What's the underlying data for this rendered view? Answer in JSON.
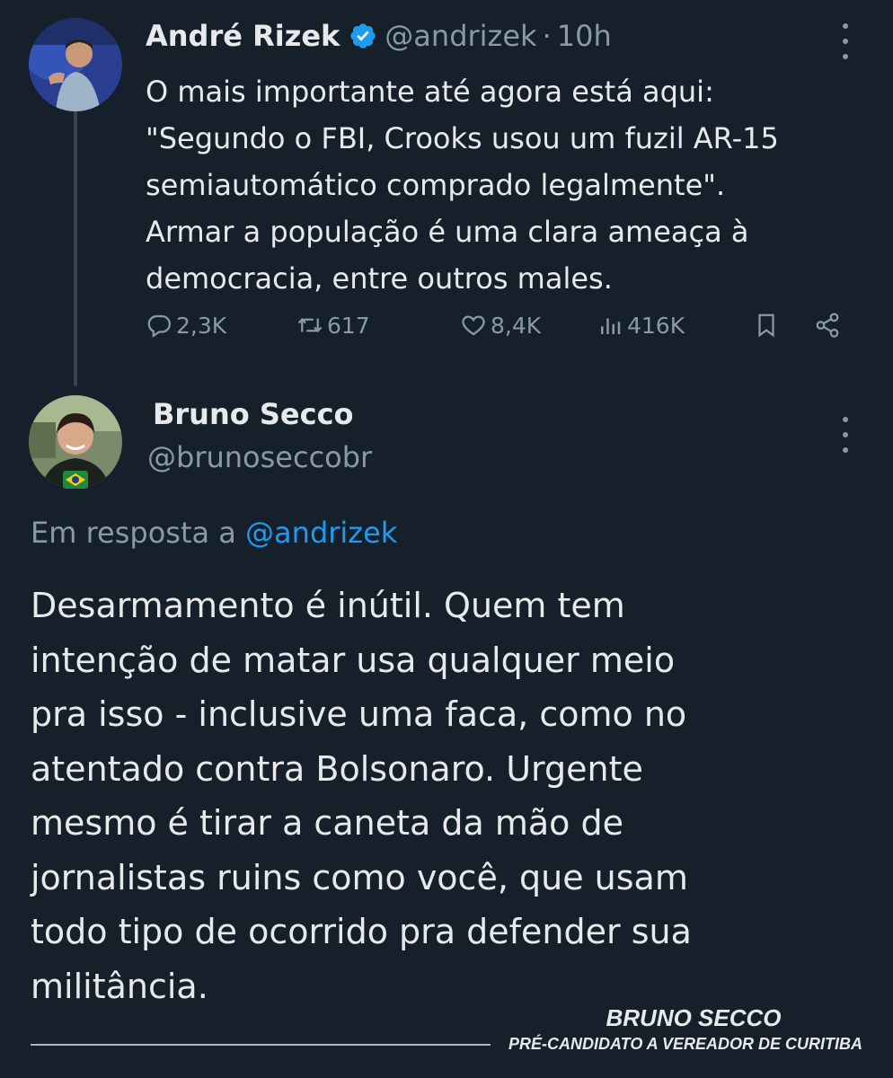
{
  "tweet1": {
    "author_name": "André Rizek",
    "handle": "@andrizek",
    "separator": "·",
    "time": "10h",
    "body_lines": [
      "O mais importante até agora está aqui:",
      "\"Segundo o FBI, Crooks usou um fuzil AR-15",
      "semiautomático comprado legalmente\".",
      "Armar a população é uma clara ameaça à",
      "democracia, entre outros males."
    ],
    "stats": {
      "replies": "2,3K",
      "retweets": "617",
      "likes": "8,4K",
      "views": "416K"
    },
    "icons": [
      "verified-badge-icon",
      "more-icon",
      "reply-icon",
      "retweet-icon",
      "like-icon",
      "views-icon",
      "bookmark-icon",
      "share-icon"
    ]
  },
  "tweet2": {
    "author_name": "Bruno Secco",
    "handle": "@brunoseccobr",
    "reply_prefix": "Em resposta a",
    "reply_mention": "@andrizek",
    "body_lines": [
      "Desarmamento é inútil. Quem tem",
      "intenção de matar usa qualquer meio",
      "pra isso - inclusive uma faca, como no",
      "atentado contra Bolsonaro. Urgente",
      "mesmo é tirar a caneta da mão de",
      "jornalistas ruins como você, que usam",
      "todo tipo de ocorrido pra defender sua",
      "militância."
    ]
  },
  "signature": {
    "name": "BRUNO SECCO",
    "subtitle": "PRÉ-CANDIDATO A VEREADOR DE CURITIBA"
  },
  "colors": {
    "background": "#15202b",
    "text": "#e7e9ea",
    "muted": "#8b98a5",
    "link": "#1d9bf0",
    "verified": "#1d9bf0"
  }
}
